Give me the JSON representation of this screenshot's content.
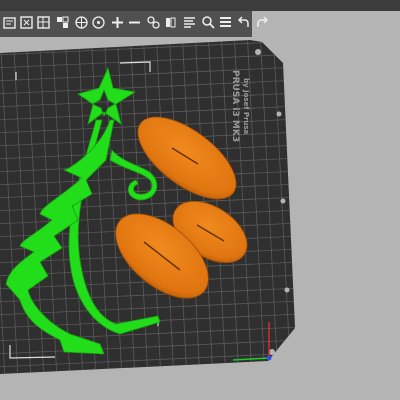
{
  "app": "PrusaSlicer",
  "toolbar": {
    "buttons": [
      {
        "name": "add-icon"
      },
      {
        "name": "delete-icon"
      },
      {
        "name": "delete-all-icon"
      },
      {
        "name": "arrange-icon"
      },
      {
        "name": "copy-icon"
      },
      {
        "name": "paste-icon"
      },
      {
        "name": "add-instance-icon"
      },
      {
        "name": "remove-instance-icon"
      },
      {
        "name": "split-objects-icon"
      },
      {
        "name": "split-parts-icon"
      },
      {
        "name": "variable-layer-height-icon"
      },
      {
        "name": "search-icon"
      },
      {
        "name": "layers-icon"
      },
      {
        "name": "undo-icon"
      },
      {
        "name": "redo-icon"
      }
    ]
  },
  "bed": {
    "brand_line1": "PRUSA i3 MK3",
    "brand_line2": "by Josef Prusa"
  },
  "colors": {
    "bed_surface": "#333333",
    "grid": "#5e5e5e",
    "tree_object": "#22dd1a",
    "leaf_objects": "#e87b10",
    "background": "#b4b4b4"
  }
}
